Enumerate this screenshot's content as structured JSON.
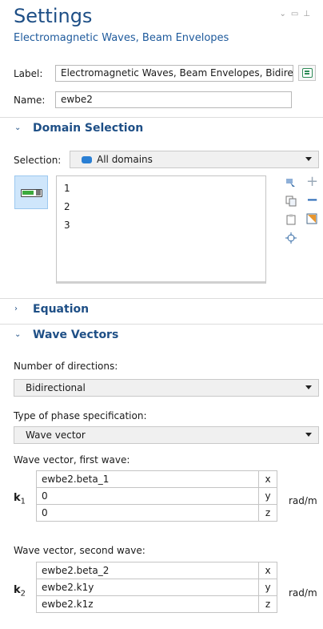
{
  "window": {
    "title": "Settings",
    "subtitle": "Electromagnetic Waves, Beam Envelopes"
  },
  "label_field": {
    "label": "Label:",
    "value": "Electromagnetic Waves, Beam Envelopes, Bidirec"
  },
  "name_field": {
    "label": "Name:",
    "value": "ewbe2"
  },
  "domain_selection": {
    "title": "Domain Selection",
    "selection_label": "Selection:",
    "selection_value": "All domains",
    "domains": [
      "1",
      "2",
      "3"
    ]
  },
  "equation": {
    "title": "Equation"
  },
  "wave_vectors": {
    "title": "Wave Vectors",
    "num_directions_label": "Number of directions:",
    "num_directions_value": "Bidirectional",
    "phase_spec_label": "Type of phase specification:",
    "phase_spec_value": "Wave vector",
    "first": {
      "label": "Wave vector, first wave:",
      "symbol": "k",
      "subscript": "1",
      "rows": [
        {
          "value": "ewbe2.beta_1",
          "comp": "x"
        },
        {
          "value": "0",
          "comp": "y"
        },
        {
          "value": "0",
          "comp": "z"
        }
      ],
      "unit": "rad/m"
    },
    "second": {
      "label": "Wave vector, second wave:",
      "symbol": "k",
      "subscript": "2",
      "rows": [
        {
          "value": "ewbe2.beta_2",
          "comp": "x"
        },
        {
          "value": "ewbe2.k1y",
          "comp": "y"
        },
        {
          "value": "ewbe2.k1z",
          "comp": "z"
        }
      ],
      "unit": "rad/m"
    }
  },
  "colors": {
    "accent": "#1e4f86",
    "domain_chip": "#2a7fd4",
    "active_toggle": "#cfe6fb"
  }
}
